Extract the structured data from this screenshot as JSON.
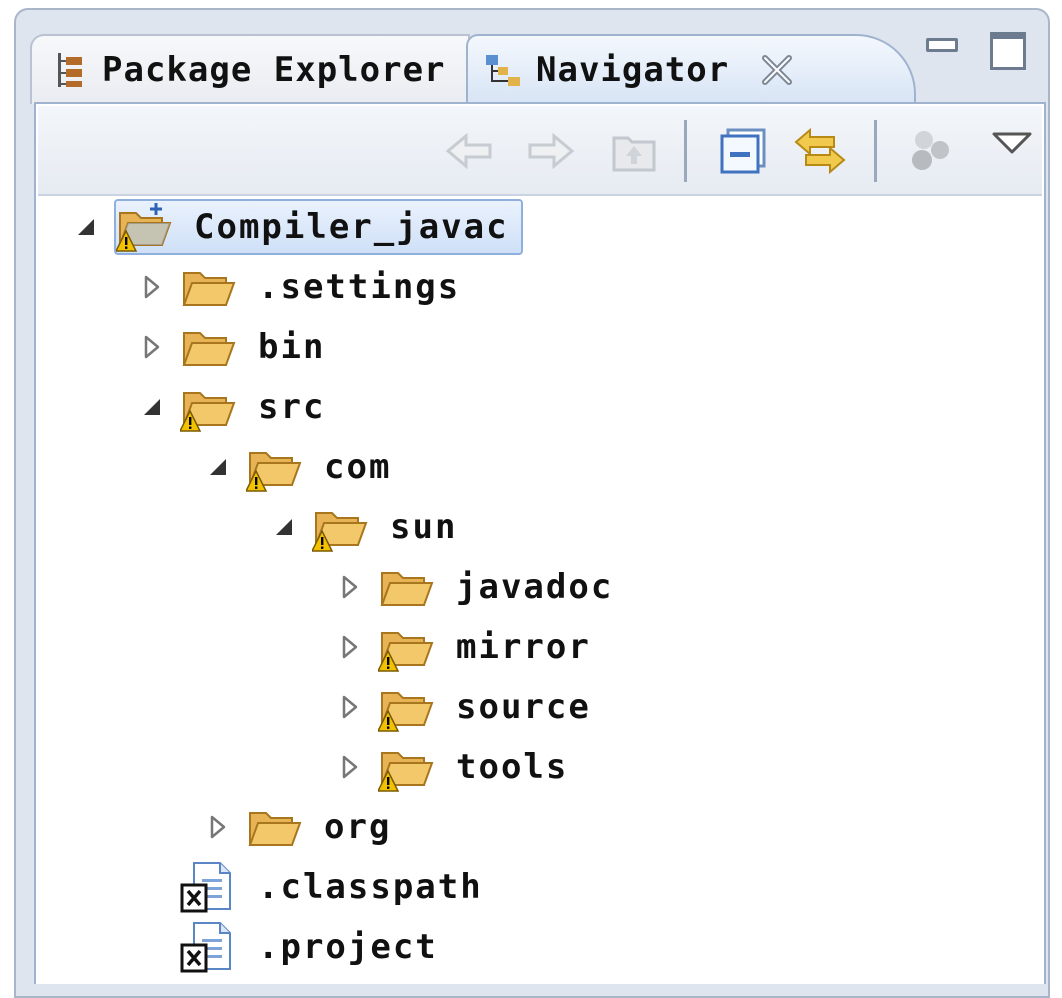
{
  "tabs": [
    {
      "label": "Package Explorer",
      "icon": "package-explorer-icon"
    },
    {
      "label": "Navigator",
      "icon": "navigator-icon",
      "active": true
    }
  ],
  "toolbar": {
    "buttons": [
      "back-icon",
      "forward-icon",
      "up-icon",
      "collapse-all-icon",
      "link-with-editor-icon",
      "working-sets-icon",
      "view-menu-icon"
    ]
  },
  "tree": [
    {
      "label": "Compiler_javac",
      "type": "project",
      "expanded": true,
      "warning": true,
      "selected": true,
      "depth": 0
    },
    {
      "label": ".settings",
      "type": "folder",
      "expanded": false,
      "warning": false,
      "depth": 1
    },
    {
      "label": "bin",
      "type": "folder",
      "expanded": false,
      "warning": false,
      "depth": 1
    },
    {
      "label": "src",
      "type": "folder",
      "expanded": true,
      "warning": true,
      "depth": 1
    },
    {
      "label": "com",
      "type": "folder",
      "expanded": true,
      "warning": true,
      "depth": 2
    },
    {
      "label": "sun",
      "type": "folder",
      "expanded": true,
      "warning": true,
      "depth": 3
    },
    {
      "label": "javadoc",
      "type": "folder",
      "expanded": false,
      "warning": false,
      "depth": 4
    },
    {
      "label": "mirror",
      "type": "folder",
      "expanded": false,
      "warning": true,
      "depth": 4
    },
    {
      "label": "source",
      "type": "folder",
      "expanded": false,
      "warning": true,
      "depth": 4
    },
    {
      "label": "tools",
      "type": "folder",
      "expanded": false,
      "warning": true,
      "depth": 4
    },
    {
      "label": "org",
      "type": "folder",
      "expanded": false,
      "warning": false,
      "depth": 2
    },
    {
      "label": ".classpath",
      "type": "xml-file",
      "depth": 1
    },
    {
      "label": ".project",
      "type": "xml-file",
      "depth": 1
    }
  ],
  "colors": {
    "folder": "#f3c86a",
    "warning": "#f2c200",
    "selection": "#cfe0f7",
    "tab_active": "#d7e4f5"
  }
}
